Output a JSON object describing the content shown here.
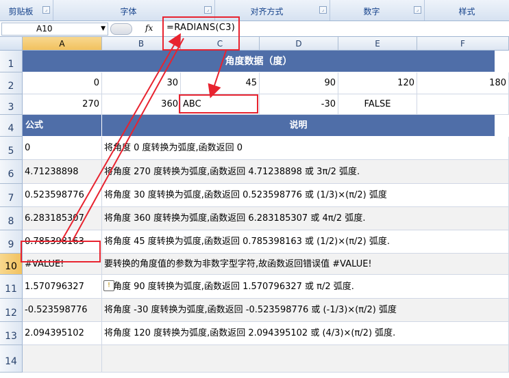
{
  "ribbon": {
    "groups": [
      {
        "label": "剪贴板"
      },
      {
        "label": "字体"
      },
      {
        "label": "对齐方式"
      },
      {
        "label": "数字"
      },
      {
        "label": "样式"
      }
    ]
  },
  "formula_bar": {
    "name_box": "A10",
    "fx_label": "fx",
    "formula": "=RADIANS(C3)"
  },
  "columns": [
    "A",
    "B",
    "C",
    "D",
    "E",
    "F"
  ],
  "rows": [
    "1",
    "2",
    "3",
    "4",
    "5",
    "6",
    "7",
    "8",
    "9",
    "10",
    "11",
    "12",
    "13",
    "14"
  ],
  "sheet": {
    "title": "角度数据（度）",
    "r2": [
      "0",
      "30",
      "45",
      "90",
      "120",
      "180"
    ],
    "r3": [
      "270",
      "360",
      "ABC",
      "-30",
      "FALSE",
      ""
    ],
    "hdr_formula": "公式",
    "hdr_desc": "说明",
    "results": [
      {
        "a": "0",
        "desc": "将角度 0 度转换为弧度,函数返回 0"
      },
      {
        "a": "4.71238898",
        "desc": "将角度 270 度转换为弧度,函数返回 4.71238898  或 3π/2 弧度."
      },
      {
        "a": "0.523598776",
        "desc": "将角度 30 度转换为弧度,函数返回 0.523598776  或 (1/3)×(π/2) 弧度"
      },
      {
        "a": "6.283185307",
        "desc": "将角度 360 度转换为弧度,函数返回 6.283185307  或 4π/2 弧度."
      },
      {
        "a": "0.785398163",
        "desc": "将角度 45 度转换为弧度,函数返回 0.785398163  或 (1/2)×(π/2) 弧度."
      },
      {
        "a": "#VALUE!",
        "desc": "要转换的角度值的参数为非数字型字符,故函数返回错误值 #VALUE!"
      },
      {
        "a": "1.570796327",
        "desc": "将角度 90 度转换为弧度,函数返回 1.570796327  或 π/2 弧度."
      },
      {
        "a": "-0.523598776",
        "desc": "将角度 -30 度转换为弧度,函数返回 -0.523598776  或 (-1/3)×(π/2) 弧度"
      },
      {
        "a": "2.094395102",
        "desc": "将角度 120 度转换为弧度,函数返回 2.094395102  或 (4/3)×(π/2) 弧度."
      },
      {
        "a": "",
        "desc": ""
      }
    ]
  },
  "colors": {
    "header_fill": "#4f6ea8",
    "annotation": "#e8232f"
  }
}
